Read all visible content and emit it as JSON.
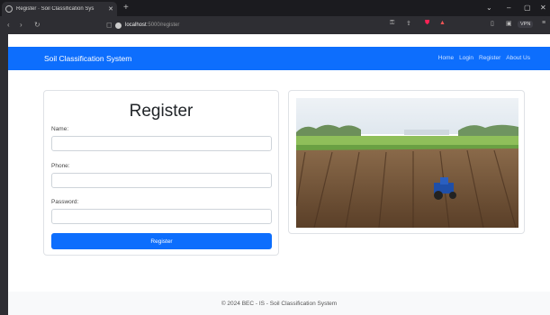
{
  "browser": {
    "tab_title": "Register · Soil Classification Sys",
    "url_host": "localhost",
    "url_path": ":5000/register",
    "vpn_label": "VPN"
  },
  "navbar": {
    "brand": "Soil Classification System",
    "links": [
      "Home",
      "Login",
      "Register",
      "About Us"
    ],
    "accent_color": "#0d6efd"
  },
  "form": {
    "title": "Register",
    "name_label": "Name:",
    "phone_label": "Phone:",
    "password_label": "Password:",
    "submit_label": "Register"
  },
  "footer": {
    "text": "© 2024 BEC - IS - Soil Classification System"
  }
}
